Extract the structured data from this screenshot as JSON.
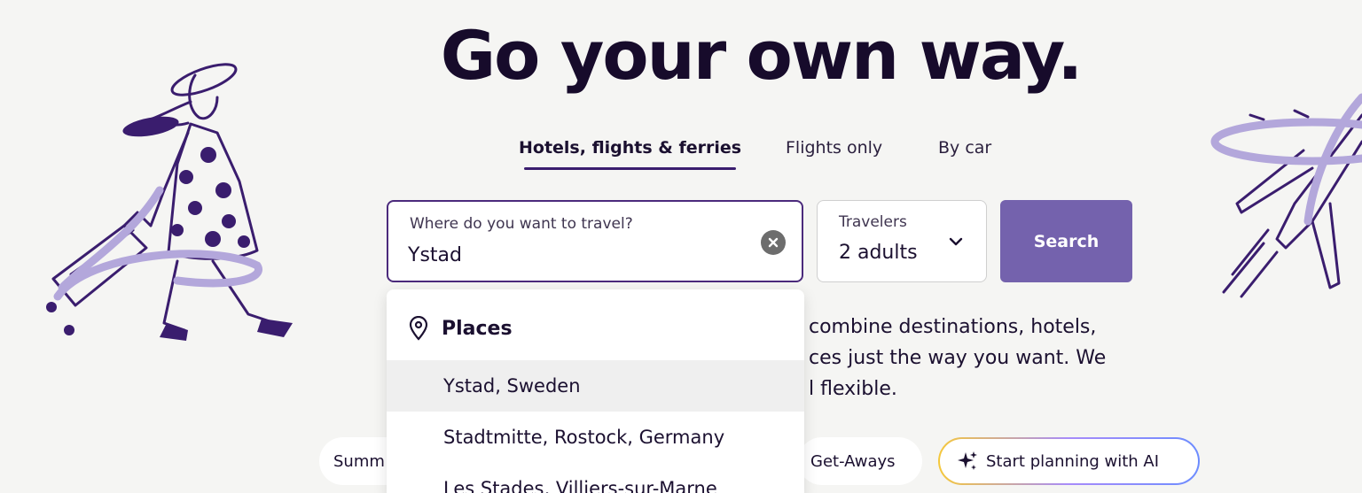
{
  "hero": {
    "title": "Go your own way."
  },
  "tabs": [
    {
      "label": "Hotels, flights & ferries",
      "active": true
    },
    {
      "label": "Flights only",
      "active": false
    },
    {
      "label": "By car",
      "active": false
    }
  ],
  "search": {
    "destination_label": "Where do you want to travel?",
    "destination_value": "Ystad",
    "travelers_label": "Travelers",
    "travelers_value": "2 adults",
    "button_label": "Search"
  },
  "dropdown": {
    "section_title": "Places",
    "items": [
      "Ystad, Sweden",
      "Stadtmitte, Rostock, Germany",
      "Les Stades, Villiers-sur-Marne"
    ]
  },
  "intro": {
    "lines": [
      "combine destinations, hotels,",
      "ces just the way you want. We",
      "l flexible."
    ]
  },
  "pills": {
    "left_partial": "Summ",
    "getaways": "Get-Aways",
    "ai": "Start planning with AI"
  },
  "colors": {
    "accent_purple": "#7462ad",
    "dark_purple": "#3a1d6e",
    "background": "#f5f5f3"
  }
}
